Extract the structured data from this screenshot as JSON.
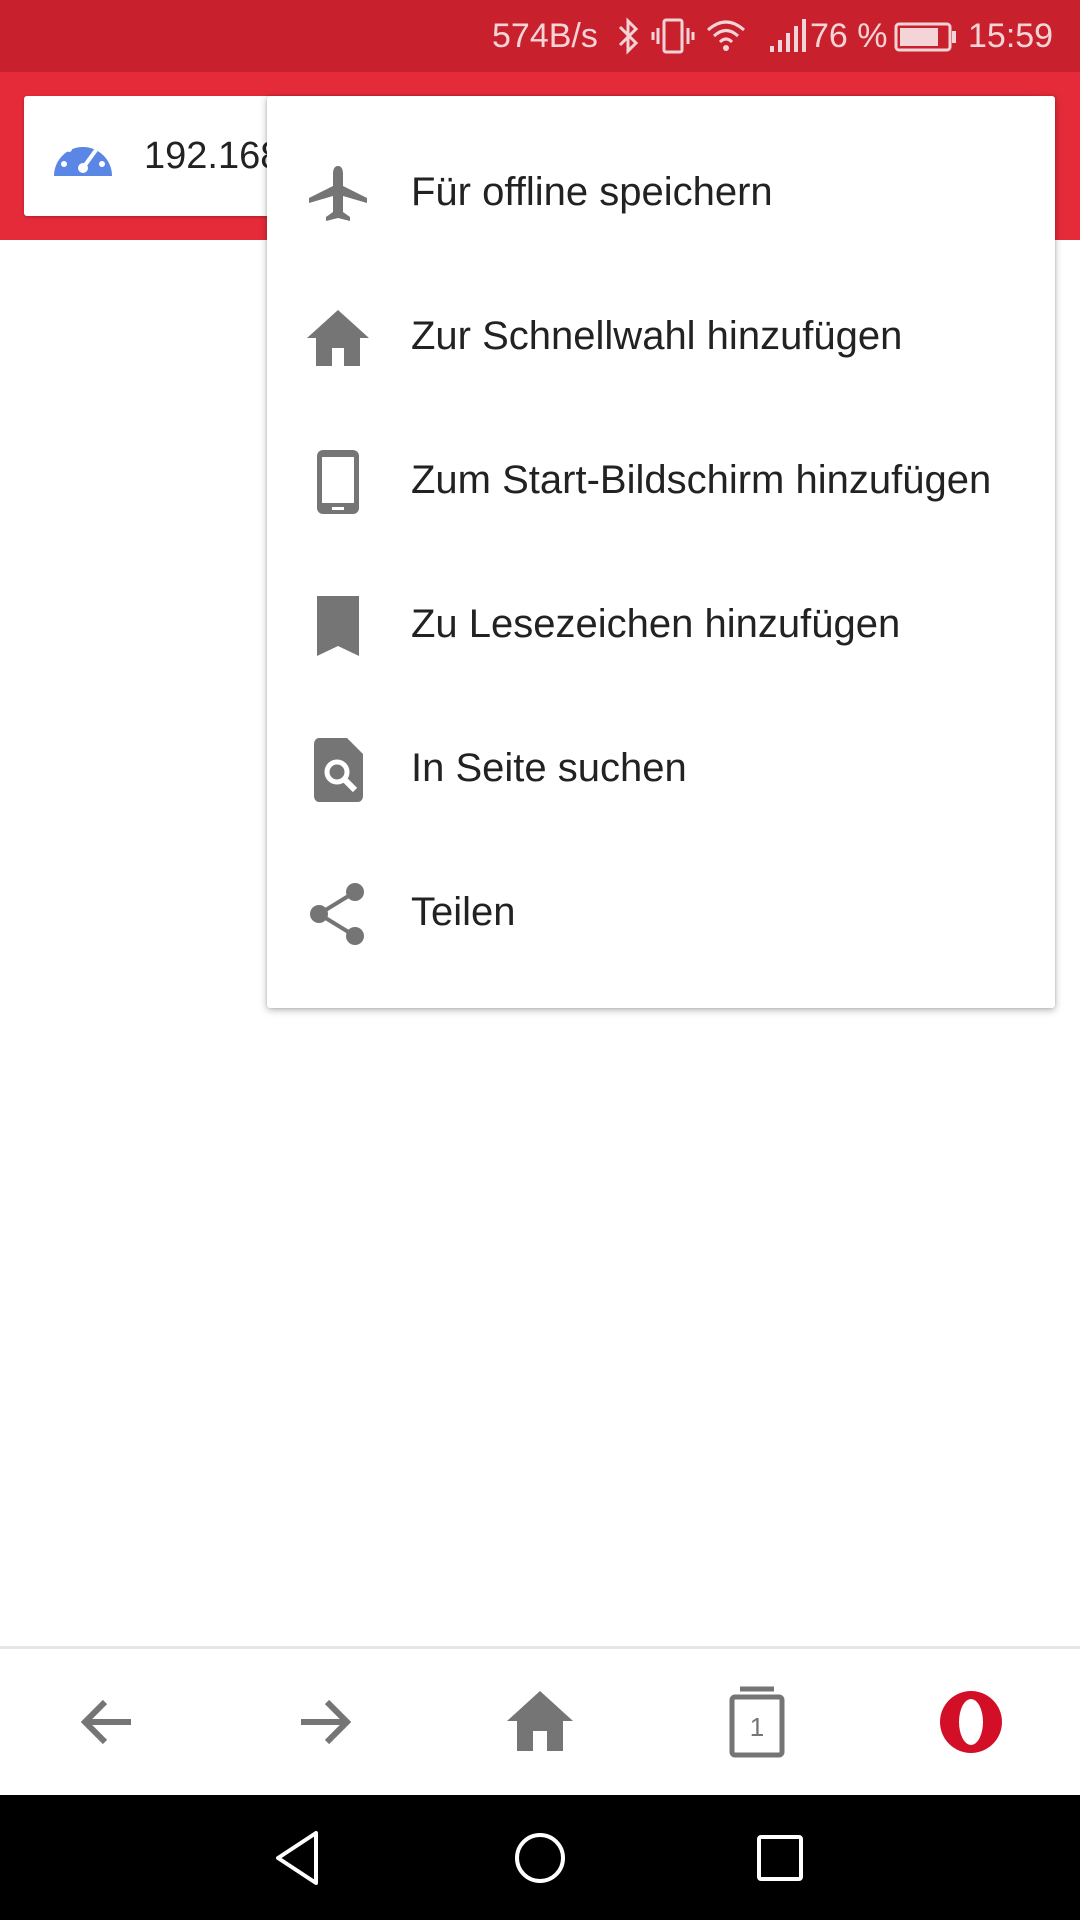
{
  "status_bar": {
    "net_speed": "574B/s",
    "battery": "76 %",
    "time": "15:59",
    "icons": [
      "bluetooth-icon",
      "vibrate-icon",
      "wifi-icon",
      "cellular-signal-icon",
      "battery-icon"
    ]
  },
  "address_bar": {
    "url": "192.168.",
    "site_icon": "speedometer-icon"
  },
  "menu": {
    "items": [
      {
        "label": "Für offline speichern",
        "icon": "airplane-icon"
      },
      {
        "label": "Zur Schnellwahl hinzufügen",
        "icon": "home-icon"
      },
      {
        "label": "Zum Start-Bildschirm hinzufügen",
        "icon": "phone-icon"
      },
      {
        "label": "Zu Lesezeichen hinzufügen",
        "icon": "bookmark-icon"
      },
      {
        "label": "In Seite suchen",
        "icon": "find-in-page-icon"
      },
      {
        "label": "Teilen",
        "icon": "share-icon"
      }
    ]
  },
  "bottom_nav": {
    "tab_count": "1",
    "buttons": [
      "back-arrow-icon",
      "forward-arrow-icon",
      "home-icon",
      "tabs-icon",
      "opera-menu-icon"
    ]
  },
  "system_nav": {
    "buttons": [
      "back-triangle-icon",
      "home-circle-icon",
      "recents-square-icon"
    ]
  },
  "colors": {
    "status_bar": "#c8202d",
    "toolbar": "#e52b3a",
    "icon_gray": "#757575",
    "site_icon_blue": "#5a86e6",
    "opera_red": "#d20f27"
  }
}
